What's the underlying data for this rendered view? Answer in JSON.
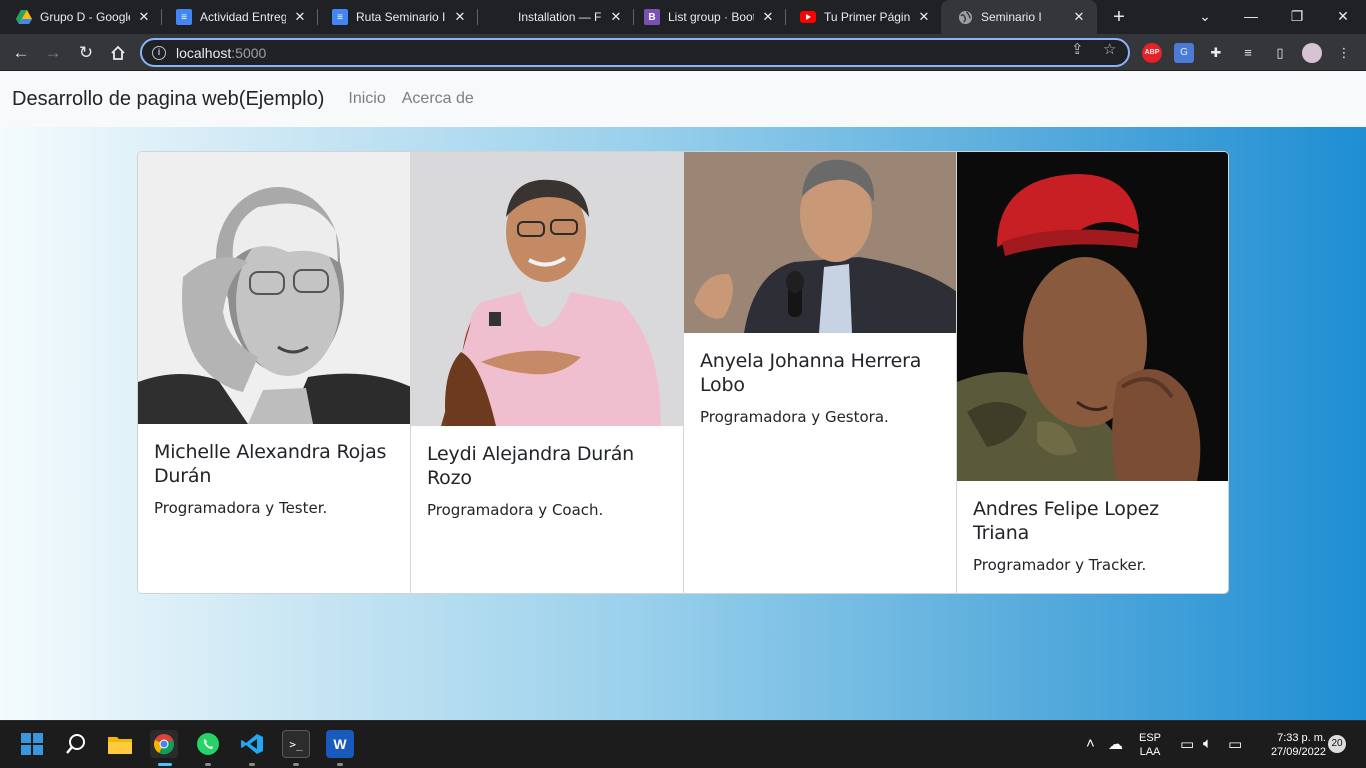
{
  "browser": {
    "tabs": [
      {
        "title": "Grupo D - Google",
        "favicon": "drive-icon",
        "color": "#1fa463"
      },
      {
        "title": "Actividad Entrega",
        "favicon": "docs-icon",
        "color": "#4285f4"
      },
      {
        "title": "Ruta Seminario In",
        "favicon": "docs-icon",
        "color": "#4285f4"
      },
      {
        "title": "Installation — Fla",
        "favicon": "flask-icon",
        "color": "#202124"
      },
      {
        "title": "List group · Boots",
        "favicon": "bootstrap-icon",
        "color": "#7952b3"
      },
      {
        "title": "Tu Primer Página",
        "favicon": "youtube-icon",
        "color": "#ff0000"
      },
      {
        "title": "Seminario I",
        "favicon": "globe-icon",
        "color": "#9aa0a6",
        "active": true
      }
    ],
    "bootstrap_letter": "B",
    "address": {
      "host": "localhost",
      "port": ":5000"
    },
    "extensions": {
      "abp": "ABP"
    }
  },
  "page": {
    "navbar": {
      "brand": "Desarrollo de pagina web(Ejemplo)",
      "links": [
        "Inicio",
        "Acerca de"
      ]
    },
    "cards": [
      {
        "name": "Michelle Alexandra Rojas Durán",
        "role": "Programadora y Tester.",
        "photo": "grayscale-portrait-hand-on-temple"
      },
      {
        "name": "Leydi Alejandra Durán Rozo",
        "role": "Programadora y Coach.",
        "photo": "portrait-pink-shirt-chair"
      },
      {
        "name": "Anyela Johanna Herrera Lobo",
        "role": "Programadora y Gestora.",
        "photo": "portrait-speaking-microphone"
      },
      {
        "name": "Andres Felipe Lopez Triana",
        "role": "Programador y Tracker.",
        "photo": "portrait-red-beret"
      }
    ]
  },
  "taskbar": {
    "apps": [
      "start-icon",
      "search-icon",
      "file-explorer-icon",
      "chrome-icon",
      "whatsapp-icon",
      "vscode-icon",
      "terminal-icon",
      "word-icon"
    ],
    "word_letter": "W",
    "lang": {
      "line1": "ESP",
      "line2": "LAA"
    },
    "time": "7:33 p. m.",
    "date": "27/09/2022",
    "notifications": "20"
  }
}
